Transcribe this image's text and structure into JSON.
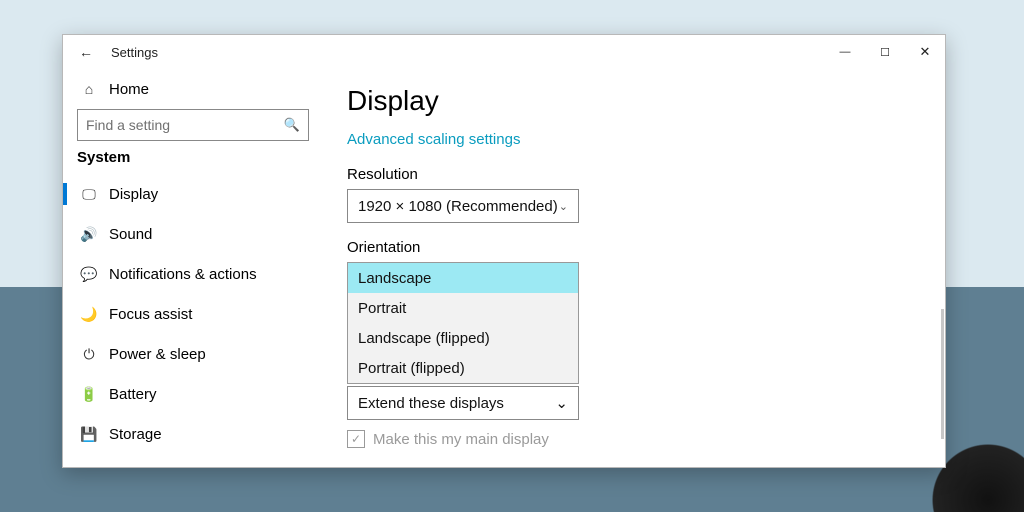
{
  "window": {
    "title": "Settings"
  },
  "sidebar": {
    "home": "Home",
    "search_placeholder": "Find a setting",
    "category": "System",
    "items": [
      {
        "icon": "🖵",
        "label": "Display",
        "active": true
      },
      {
        "icon": "🔊",
        "label": "Sound"
      },
      {
        "icon": "💬",
        "label": "Notifications & actions"
      },
      {
        "icon": "🌙",
        "label": "Focus assist"
      },
      {
        "icon": "⏻",
        "label": "Power & sleep"
      },
      {
        "icon": "🔋",
        "label": "Battery"
      },
      {
        "icon": "💾",
        "label": "Storage"
      }
    ]
  },
  "content": {
    "heading": "Display",
    "scaling_link": "Advanced scaling settings",
    "resolution_label": "Resolution",
    "resolution_value": "1920 × 1080 (Recommended)",
    "orientation_label": "Orientation",
    "orientation_options": {
      "o0": "Landscape",
      "o1": "Portrait",
      "o2": "Landscape (flipped)",
      "o3": "Portrait (flipped)"
    },
    "multi_display_value": "Extend these displays",
    "main_display_label": "Make this my main display"
  }
}
